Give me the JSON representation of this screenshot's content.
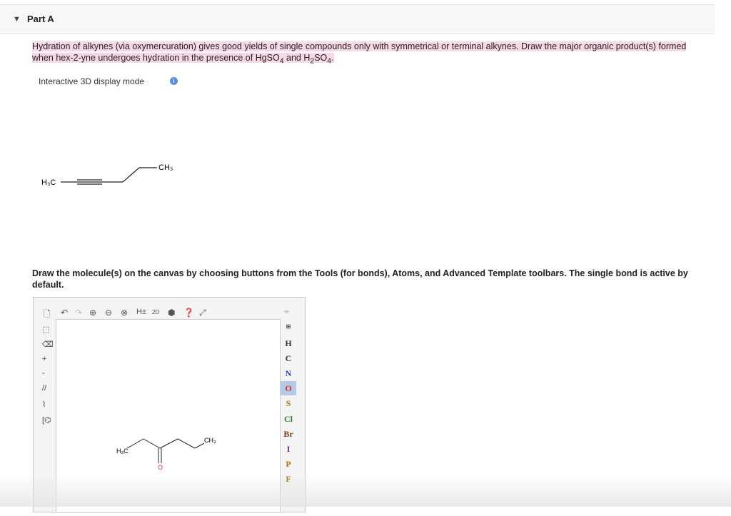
{
  "section": {
    "title": "Part A"
  },
  "question": {
    "line1": "Hydration of alkynes (via oxymercuration) gives good yields of single compounds only with symmetrical or terminal alkynes. Draw the major organic product(s) formed",
    "line2_pre": "when hex-2-yne undergoes hydration in the presence of HgSO",
    "line2_mid": " and H",
    "line2_mid2": "SO",
    "sub4": "4",
    "sub2": "2",
    "line2_end": "."
  },
  "display_mode": {
    "label": "Interactive 3D display mode",
    "info_icon": "info-icon"
  },
  "molecule_preview": {
    "left_label": "H₃C",
    "right_label": "CH₃"
  },
  "instruction": "Draw the molecule(s) on the canvas by choosing buttons from the Tools (for bonds), Atoms, and Advanced Template toolbars. The single bond is active by default.",
  "editor": {
    "toolbar": [
      "new-icon",
      "undo-icon",
      "redo-icon",
      "zoom-in-icon",
      "zoom-out-icon",
      "zoom-reset-icon",
      "H±",
      "2D",
      "info-icon",
      "help-icon",
      "expand-icon"
    ],
    "h_toggle": "H±",
    "two_d": "2D",
    "atoms": [
      {
        "symbol": "H",
        "color": "#333333"
      },
      {
        "symbol": "C",
        "color": "#333333"
      },
      {
        "symbol": "N",
        "color": "#2a3fb5"
      },
      {
        "symbol": "O",
        "color": "#d0302a",
        "selected": true
      },
      {
        "symbol": "S",
        "color": "#a07a10"
      },
      {
        "symbol": "Cl",
        "color": "#2a8a2a"
      },
      {
        "symbol": "Br",
        "color": "#7a3a1a"
      },
      {
        "symbol": "I",
        "color": "#6a2aa0"
      },
      {
        "symbol": "P",
        "color": "#c06a10"
      },
      {
        "symbol": "F",
        "color": "#a07a10"
      }
    ],
    "canvas_molecule": {
      "left_label": "H₃C",
      "right_label": "CH₃",
      "oxygen": "O"
    }
  }
}
